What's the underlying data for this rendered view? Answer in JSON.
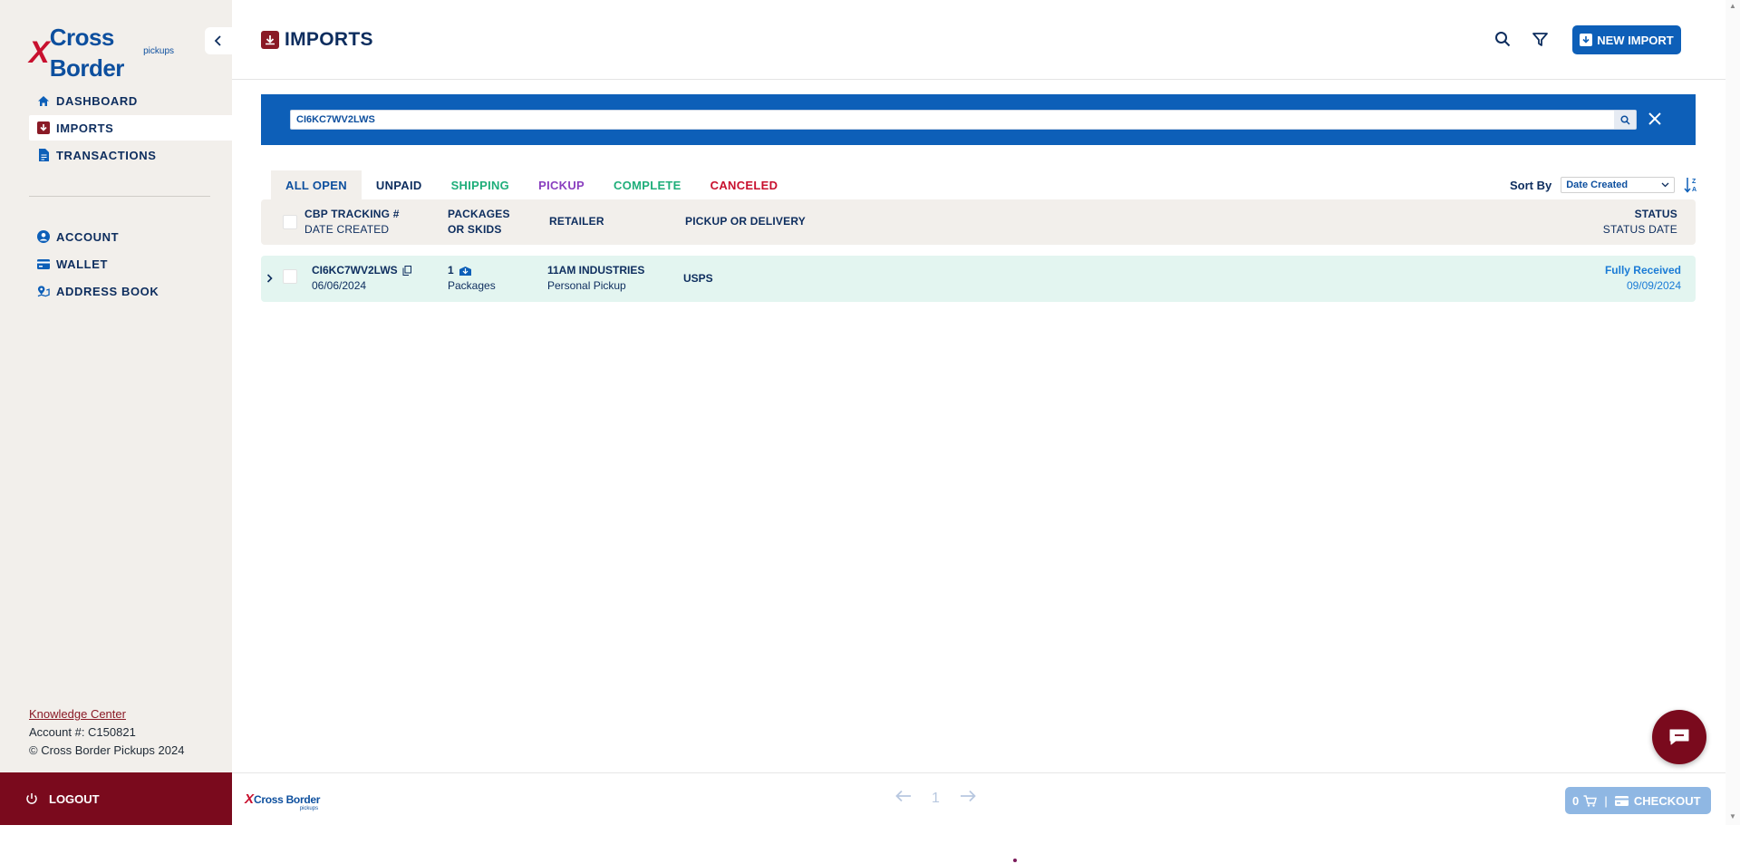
{
  "brand": {
    "logo_x": "X",
    "logo_text": "Cross Border",
    "logo_sub": "pickups"
  },
  "sidebar": {
    "items": [
      {
        "label": "DASHBOARD",
        "icon": "home-icon"
      },
      {
        "label": "IMPORTS",
        "icon": "import-icon",
        "active": true
      },
      {
        "label": "TRANSACTIONS",
        "icon": "document-icon"
      },
      {
        "label": "ACCOUNT",
        "icon": "user-circle-icon"
      },
      {
        "label": "WALLET",
        "icon": "card-icon"
      },
      {
        "label": "ADDRESS BOOK",
        "icon": "map-pin-icon"
      }
    ],
    "knowledge_center": "Knowledge Center",
    "account_number": "Account #: C150821",
    "copyright": "© Cross Border Pickups 2024",
    "logout": "LOGOUT"
  },
  "header": {
    "title": "IMPORTS",
    "new_import": "NEW IMPORT"
  },
  "search": {
    "value": "CI6KC7WV2LWS"
  },
  "tabs": [
    {
      "label": "ALL OPEN",
      "color": "#0d4f9e",
      "active": true
    },
    {
      "label": "UNPAID",
      "color": "#0d2d5e"
    },
    {
      "label": "SHIPPING",
      "color": "#1fae7a"
    },
    {
      "label": "PICKUP",
      "color": "#8a3fbf"
    },
    {
      "label": "COMPLETE",
      "color": "#1fae7a"
    },
    {
      "label": "CANCELED",
      "color": "#c8102e"
    }
  ],
  "sort": {
    "label": "Sort By",
    "selected": "Date Created"
  },
  "table": {
    "headers": {
      "tracking_line1": "CBP TRACKING #",
      "tracking_line2": "DATE CREATED",
      "packages_line1": "PACKAGES",
      "packages_line2": "OR SKIDS",
      "retailer": "RETAILER",
      "pickup_delivery": "PICKUP OR DELIVERY",
      "status_line1": "STATUS",
      "status_line2": "STATUS DATE"
    },
    "rows": [
      {
        "tracking": "CI6KC7WV2LWS",
        "date_created": "06/06/2024",
        "package_count": "1",
        "package_unit": "Packages",
        "retailer": "11AM INDUSTRIES",
        "retailer_sub": "Personal Pickup",
        "pickup_delivery": "USPS",
        "status": "Fully Received",
        "status_date": "09/09/2024"
      }
    ]
  },
  "footer": {
    "page": "1",
    "cart_count": "0",
    "checkout": "CHECKOUT"
  }
}
